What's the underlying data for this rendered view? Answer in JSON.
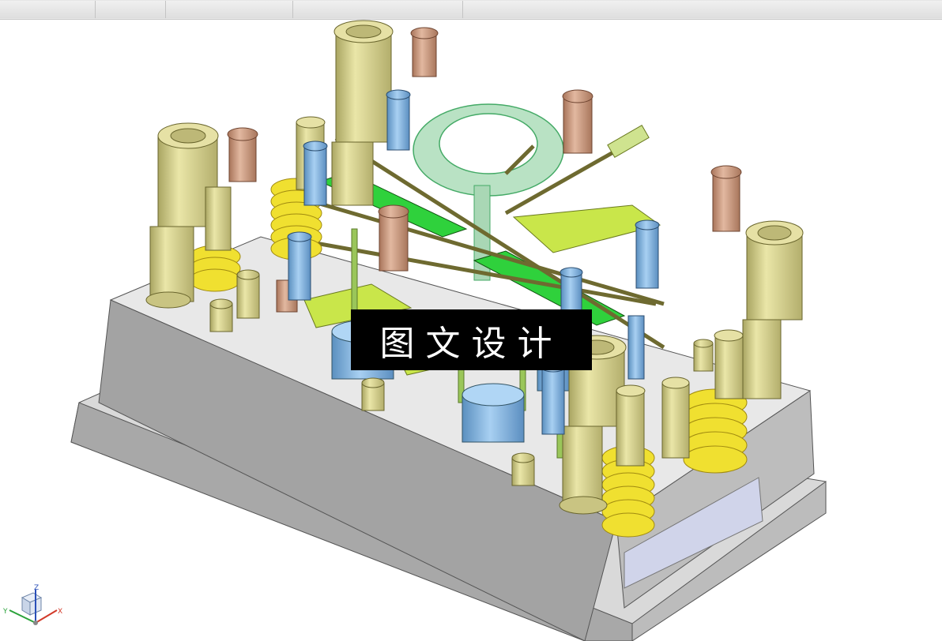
{
  "window": {
    "toolbar_segments": 5
  },
  "viewport": {
    "model": "mold-assembly-3d",
    "background_color": "#ffffff",
    "colors": {
      "plate_gray": "#c8c8c8",
      "guide_pillar": "#d6d28f",
      "spring_yellow": "#f0e030",
      "ejector_green": "#2fd13c",
      "lifter_lime": "#c9e64a",
      "screw_blue": "#7fb2e0",
      "screw_copper": "#c99577",
      "locating_ring": "#b9e2c4",
      "cylinder_blue": "#7db4e8"
    }
  },
  "watermark": {
    "text": "图文设计"
  },
  "triad": {
    "x_label": "X",
    "y_label": "Y",
    "z_label": "Z"
  }
}
